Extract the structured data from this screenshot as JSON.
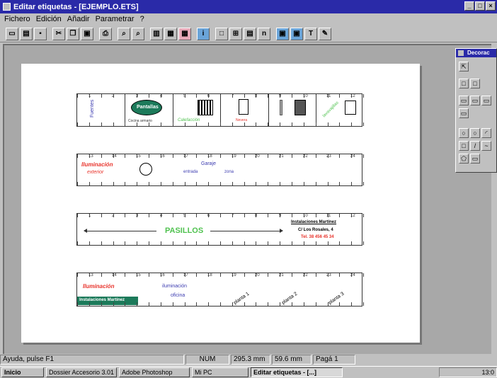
{
  "window": {
    "title": "Editar etiquetas - [EJEMPLO.ETS]"
  },
  "menu": [
    "Fichero",
    "Edición",
    "Añadir",
    "Parametrar",
    "?"
  ],
  "toolbar": {
    "text_tool": "T"
  },
  "labels": {
    "l1": {
      "numbers": [
        "1",
        "2",
        "3",
        "4",
        "5",
        "6",
        "7",
        "8",
        "9",
        "10",
        "11",
        "12"
      ],
      "texts": {
        "vertical_a": "Fuentes",
        "oval": "Pantallas",
        "below_oval": "Cocina  armario",
        "green": "Calefacción",
        "red": "Nevera",
        "diag": "lavavajillas"
      }
    },
    "l2": {
      "numbers": [
        "13",
        "14",
        "15",
        "16",
        "17",
        "18",
        "19",
        "20",
        "21",
        "22",
        "23",
        "24"
      ],
      "texts": {
        "a": "Iluminación",
        "b": "exterior",
        "garaje": "Garaje",
        "s1": "entrada",
        "s2": "zona"
      }
    },
    "l3": {
      "numbers": [
        "1",
        "2",
        "3",
        "4",
        "5",
        "6",
        "7",
        "8",
        "9",
        "10",
        "11",
        "12"
      ],
      "texts": {
        "pasillos": "PASILLOS",
        "company": "Instalaciones Martínez",
        "address": "C/ Los Rosales, 4",
        "phone": "Tel. 38 456 45 34"
      }
    },
    "l4": {
      "numbers": [
        "13",
        "14",
        "15",
        "16",
        "17",
        "18",
        "19",
        "20",
        "21",
        "22",
        "23",
        "24"
      ],
      "texts": {
        "illum": "Iluminación",
        "badge": "Instalaciones Martínez",
        "iluminacion2": "iluminación",
        "oficina": "oficina",
        "p1": "planta 1",
        "p2": "planta 2",
        "p3": "planta 3"
      }
    }
  },
  "palette": {
    "title": "Decorac"
  },
  "status": {
    "help": "Ayuda, pulse F1",
    "num": "NUM",
    "x": "295.3 mm",
    "y": "59.6 mm",
    "page": "Pagá 1"
  },
  "taskbar": {
    "start": "Inicio",
    "t1": "Dossier Accesorio 3.01",
    "t2": "Adobe Photoshop",
    "t3": "Mi PC",
    "t4": "Editar etiquetas - [...]",
    "clock": "13:0"
  },
  "colors": {
    "title_bg": "#2a2aa8",
    "red": "#e8322a",
    "blue": "#3b3bb0",
    "green": "#4fc24f",
    "teal": "#1c7a5a"
  }
}
